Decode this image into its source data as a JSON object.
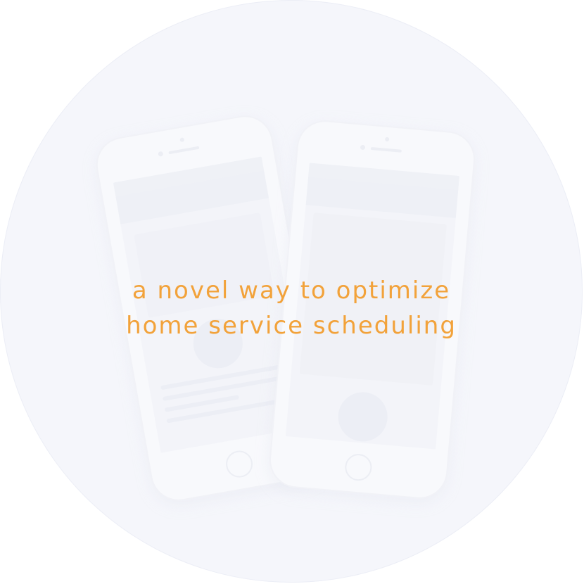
{
  "tagline": {
    "line1": "a novel way to optimize",
    "line2": "home service scheduling"
  },
  "colors": {
    "circle_background": "#f5f6fb",
    "tagline": "#f2a23a",
    "page_background": "#ffffff"
  }
}
